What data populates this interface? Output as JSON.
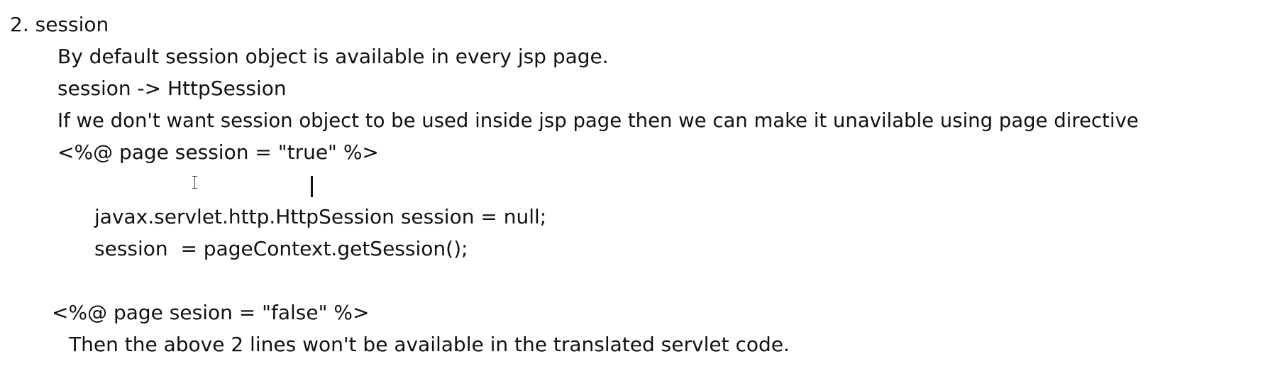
{
  "document": {
    "heading": "2. session",
    "lines": [
      "By default session object is available in every jsp page.",
      "session -> HttpSession",
      "If we don't want session object to be used inside jsp page then we can make it unavilable using page directive",
      "<%@ page session = \"true\" %>",
      "javax.servlet.http.HttpSession session = null;",
      "session  = pageContext.getSession();",
      "<%@ page sesion = \"false\" %>",
      "Then the above 2 lines won't be available in the translated servlet code."
    ]
  },
  "cursor": {
    "icon": "text-cursor-icon",
    "caret": "text-caret-icon"
  }
}
